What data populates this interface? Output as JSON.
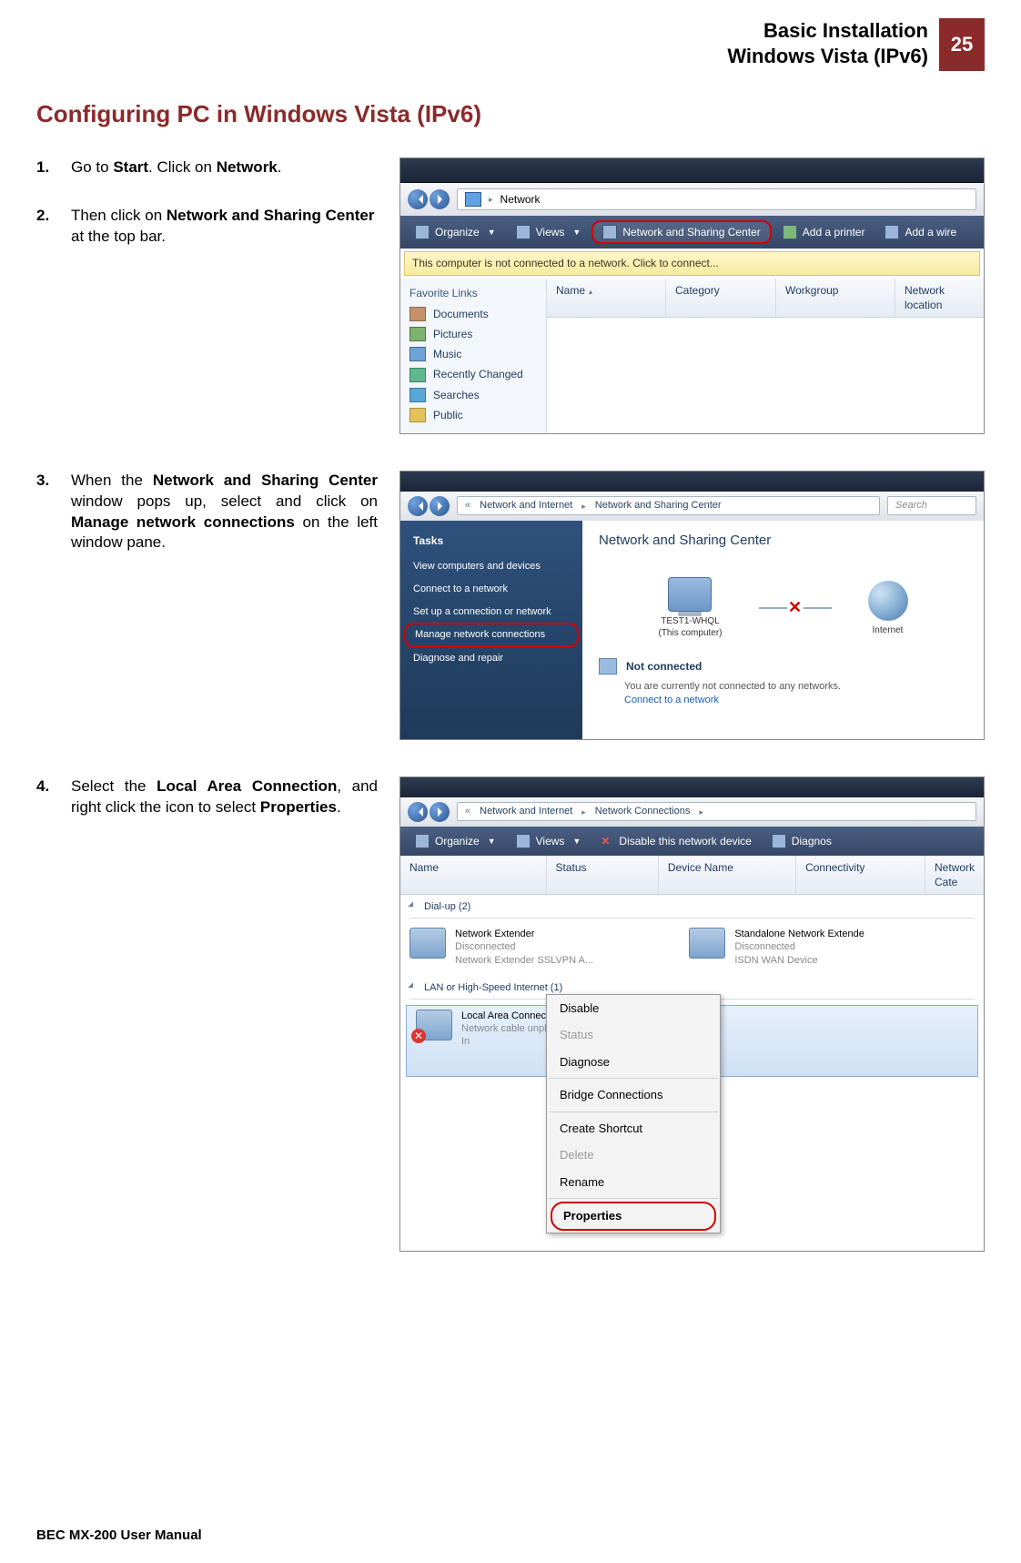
{
  "header": {
    "title_line1": "Basic Installation",
    "title_line2": "Windows Vista (IPv6)",
    "page_number": "25"
  },
  "section_title": "Configuring PC in Windows Vista (IPv6)",
  "steps": {
    "s1": {
      "num": "1.",
      "pre": "Go to ",
      "b1": "Start",
      "mid": ". Click on ",
      "b2": "Network",
      "post": "."
    },
    "s2": {
      "num": "2.",
      "pre": "Then click on ",
      "b1": "Network and Sharing Center",
      "post": " at the top bar."
    },
    "s3": {
      "num": "3.",
      "a": "When the ",
      "b1": "Network and Sharing Center",
      "b": " window pops up, select and click on ",
      "b2": "Manage network connections",
      "c": " on the left window pane."
    },
    "s4": {
      "num": "4.",
      "a": "Select the ",
      "b1": "Local Area Connection",
      "b": ", and right click the icon to select ",
      "b2": "Properties",
      "c": "."
    }
  },
  "ss1": {
    "breadcrumb": "Network",
    "toolbar": {
      "organize": "Organize",
      "views": "Views",
      "nsc": "Network and Sharing Center",
      "add_printer": "Add a printer",
      "add_wire": "Add a wire"
    },
    "infobar": "This computer is not connected to a network. Click to connect...",
    "fav_header": "Favorite Links",
    "fav": [
      "Documents",
      "Pictures",
      "Music",
      "Recently Changed",
      "Searches",
      "Public"
    ],
    "cols": [
      "Name",
      "Category",
      "Workgroup",
      "Network location"
    ]
  },
  "ss2": {
    "crumb1": "Network and Internet",
    "crumb2": "Network and Sharing Center",
    "search_ph": "Search",
    "tasks_header": "Tasks",
    "tasks": [
      "View computers and devices",
      "Connect to a network",
      "Set up a connection or network",
      "Manage network connections",
      "Diagnose and repair"
    ],
    "main_title": "Network and Sharing Center",
    "node_pc_name": "TEST1-WHQL",
    "node_pc_sub": "(This computer)",
    "node_net": "Internet",
    "status_label": "Not connected",
    "status_msg": "You are currently not connected to any networks.",
    "status_link": "Connect to a network"
  },
  "ss3": {
    "crumb1": "Network and Internet",
    "crumb2": "Network Connections",
    "toolbar": {
      "organize": "Organize",
      "views": "Views",
      "disable": "Disable this network device",
      "diagnos": "Diagnos"
    },
    "cols": [
      "Name",
      "Status",
      "Device Name",
      "Connectivity",
      "Network Cate"
    ],
    "grp_dial": "Dial-up (2)",
    "grp_lan": "LAN or High-Speed Internet (1)",
    "ne": {
      "name": "Network Extender",
      "stat": "Disconnected",
      "dev": "Network Extender SSLVPN A..."
    },
    "se": {
      "name": "Standalone Network Extende",
      "stat": "Disconnected",
      "dev": "ISDN WAN Device"
    },
    "lac": {
      "name": "Local Area Connection",
      "stat": "Network cable unplugged",
      "dev": "In"
    },
    "menu": [
      "Disable",
      "Status",
      "Diagnose",
      "Bridge Connections",
      "Create Shortcut",
      "Delete",
      "Rename",
      "Properties"
    ]
  },
  "footer": "BEC MX-200 User Manual"
}
